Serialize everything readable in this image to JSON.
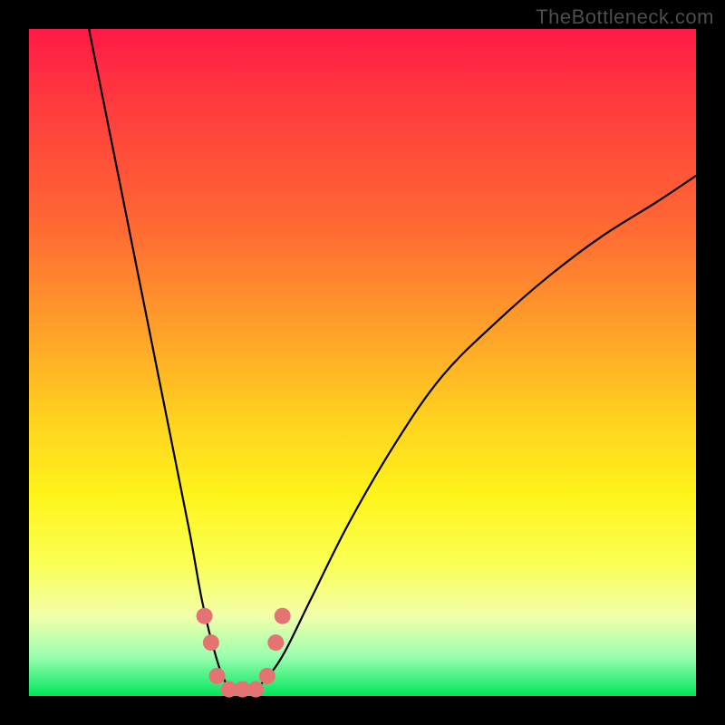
{
  "watermark": "TheBottleneck.com",
  "chart_data": {
    "type": "line",
    "title": "",
    "xlabel": "",
    "ylabel": "",
    "xlim": [
      0,
      100
    ],
    "ylim": [
      0,
      100
    ],
    "series": [
      {
        "name": "bottleneck-curve",
        "x": [
          9,
          12,
          15,
          18,
          21,
          24,
          26,
          28,
          29.5,
          31,
          33,
          35,
          38,
          42,
          48,
          55,
          62,
          70,
          78,
          86,
          94,
          100
        ],
        "values": [
          100,
          85,
          70,
          55,
          40,
          25,
          14,
          6,
          2,
          0.5,
          0.5,
          2,
          6,
          14,
          26,
          38,
          48,
          56,
          63,
          69,
          74,
          78
        ]
      }
    ],
    "markers": {
      "name": "highlight-dots",
      "color": "#e57373",
      "points": [
        {
          "x": 26.3,
          "y": 12
        },
        {
          "x": 27.3,
          "y": 8
        },
        {
          "x": 28.2,
          "y": 3
        },
        {
          "x": 30.0,
          "y": 1
        },
        {
          "x": 32.0,
          "y": 1
        },
        {
          "x": 34.0,
          "y": 1
        },
        {
          "x": 35.7,
          "y": 3
        },
        {
          "x": 37.0,
          "y": 8
        },
        {
          "x": 38.0,
          "y": 12
        }
      ]
    },
    "gradient_stops": [
      {
        "pos": 0,
        "color": "#ff1a46"
      },
      {
        "pos": 12,
        "color": "#ff3d3d"
      },
      {
        "pos": 30,
        "color": "#ff6a33"
      },
      {
        "pos": 45,
        "color": "#ffa02a"
      },
      {
        "pos": 58,
        "color": "#ffd020"
      },
      {
        "pos": 70,
        "color": "#fff41a"
      },
      {
        "pos": 80,
        "color": "#fbff53"
      },
      {
        "pos": 88,
        "color": "#f2ffaa"
      },
      {
        "pos": 94,
        "color": "#9cffb0"
      },
      {
        "pos": 100,
        "color": "#00e65c"
      }
    ]
  }
}
